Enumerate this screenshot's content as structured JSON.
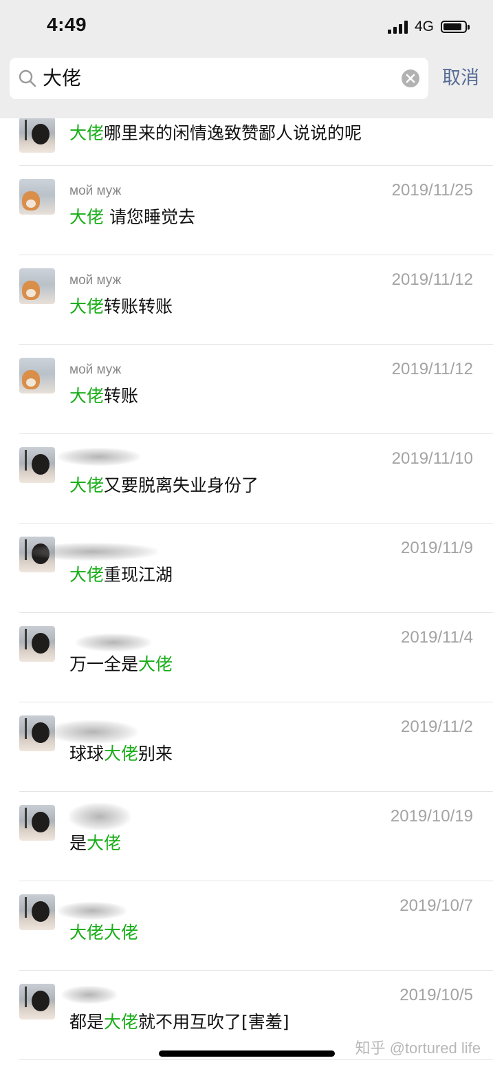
{
  "status_bar": {
    "time": "4:49",
    "network": "4G"
  },
  "search": {
    "query": "大佬",
    "cancel_label": "取消"
  },
  "results": [
    {
      "name": "",
      "date": "",
      "pre": "",
      "hl": "大佬",
      "post": "哪里来的闲情逸致赞鄙人说说的呢",
      "avatar": "person"
    },
    {
      "name": "мой муж",
      "date": "2019/11/25",
      "pre": "",
      "hl": "大佬",
      "post": " 请您睡觉去",
      "avatar": "dog"
    },
    {
      "name": "мой муж",
      "date": "2019/11/12",
      "pre": "",
      "hl": "大佬",
      "post": "转账转账",
      "avatar": "dog"
    },
    {
      "name": "мой муж",
      "date": "2019/11/12",
      "pre": "",
      "hl": "大佬",
      "post": "转账",
      "avatar": "dog"
    },
    {
      "name": "",
      "date": "2019/11/10",
      "pre": "",
      "hl": "大佬",
      "post": "又要脱离失业身份了",
      "avatar": "person"
    },
    {
      "name": "",
      "date": "2019/11/9",
      "pre": "",
      "hl": "大佬",
      "post": "重现江湖",
      "avatar": "person"
    },
    {
      "name": "",
      "date": "2019/11/4",
      "pre": "万一全是",
      "hl": "大佬",
      "post": "",
      "avatar": "person"
    },
    {
      "name": "",
      "date": "2019/11/2",
      "pre": "球球",
      "hl": "大佬",
      "post": "别来",
      "avatar": "person"
    },
    {
      "name": "",
      "date": "2019/10/19",
      "pre": "是",
      "hl": "大佬",
      "post": "",
      "avatar": "person"
    },
    {
      "name": "",
      "date": "2019/10/7",
      "pre": "",
      "hl": "大佬大佬",
      "post": "",
      "avatar": "person"
    },
    {
      "name": "",
      "date": "2019/10/5",
      "pre": "都是",
      "hl": "大佬",
      "post": "就不用互吹了[害羞]",
      "avatar": "person"
    }
  ],
  "watermark": "知乎 @tortured life"
}
